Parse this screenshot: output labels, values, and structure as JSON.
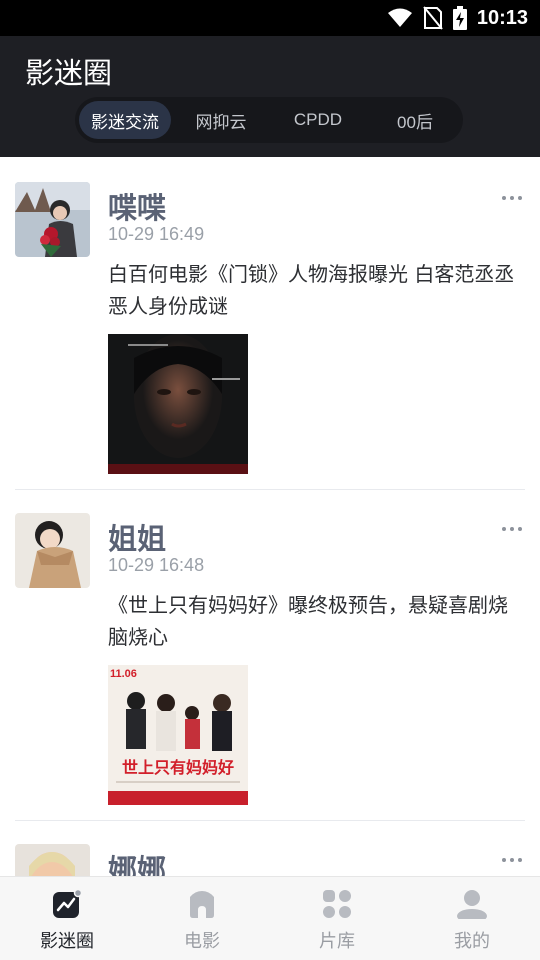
{
  "status_bar": {
    "time": "10:13",
    "icons": [
      "wifi-icon",
      "no-sim-icon",
      "battery-charging-icon"
    ]
  },
  "header": {
    "title": "影迷圈",
    "tabs": [
      {
        "label": "影迷交流",
        "active": true
      },
      {
        "label": "网抑云",
        "active": false
      },
      {
        "label": "CPDD",
        "active": false
      },
      {
        "label": "00后",
        "active": false
      }
    ]
  },
  "posts": [
    {
      "username": "喋喋",
      "timestamp": "10-29 16:49",
      "content": "白百何电影《门锁》人物海报曝光 白客范丞丞恶人身份成谜",
      "image_icon": "movie-poster-image"
    },
    {
      "username": "姐姐",
      "timestamp": "10-29 16:48",
      "content": "《世上只有妈妈好》曝终极预告，悬疑喜剧烧脑烧心",
      "image_icon": "movie-poster-image",
      "poster_date": "11.06",
      "poster_title": "世上只有妈妈好"
    },
    {
      "username": "娜娜"
    }
  ],
  "bottom_nav": [
    {
      "label": "影迷圈",
      "icon": "chart-icon",
      "active": true
    },
    {
      "label": "电影",
      "icon": "home-icon",
      "active": false
    },
    {
      "label": "片库",
      "icon": "grid-icon",
      "active": false
    },
    {
      "label": "我的",
      "icon": "user-icon",
      "active": false
    }
  ],
  "colors": {
    "header_bg": "#1e1f24",
    "active_tab": "#2b3447",
    "username": "#5a6275"
  }
}
